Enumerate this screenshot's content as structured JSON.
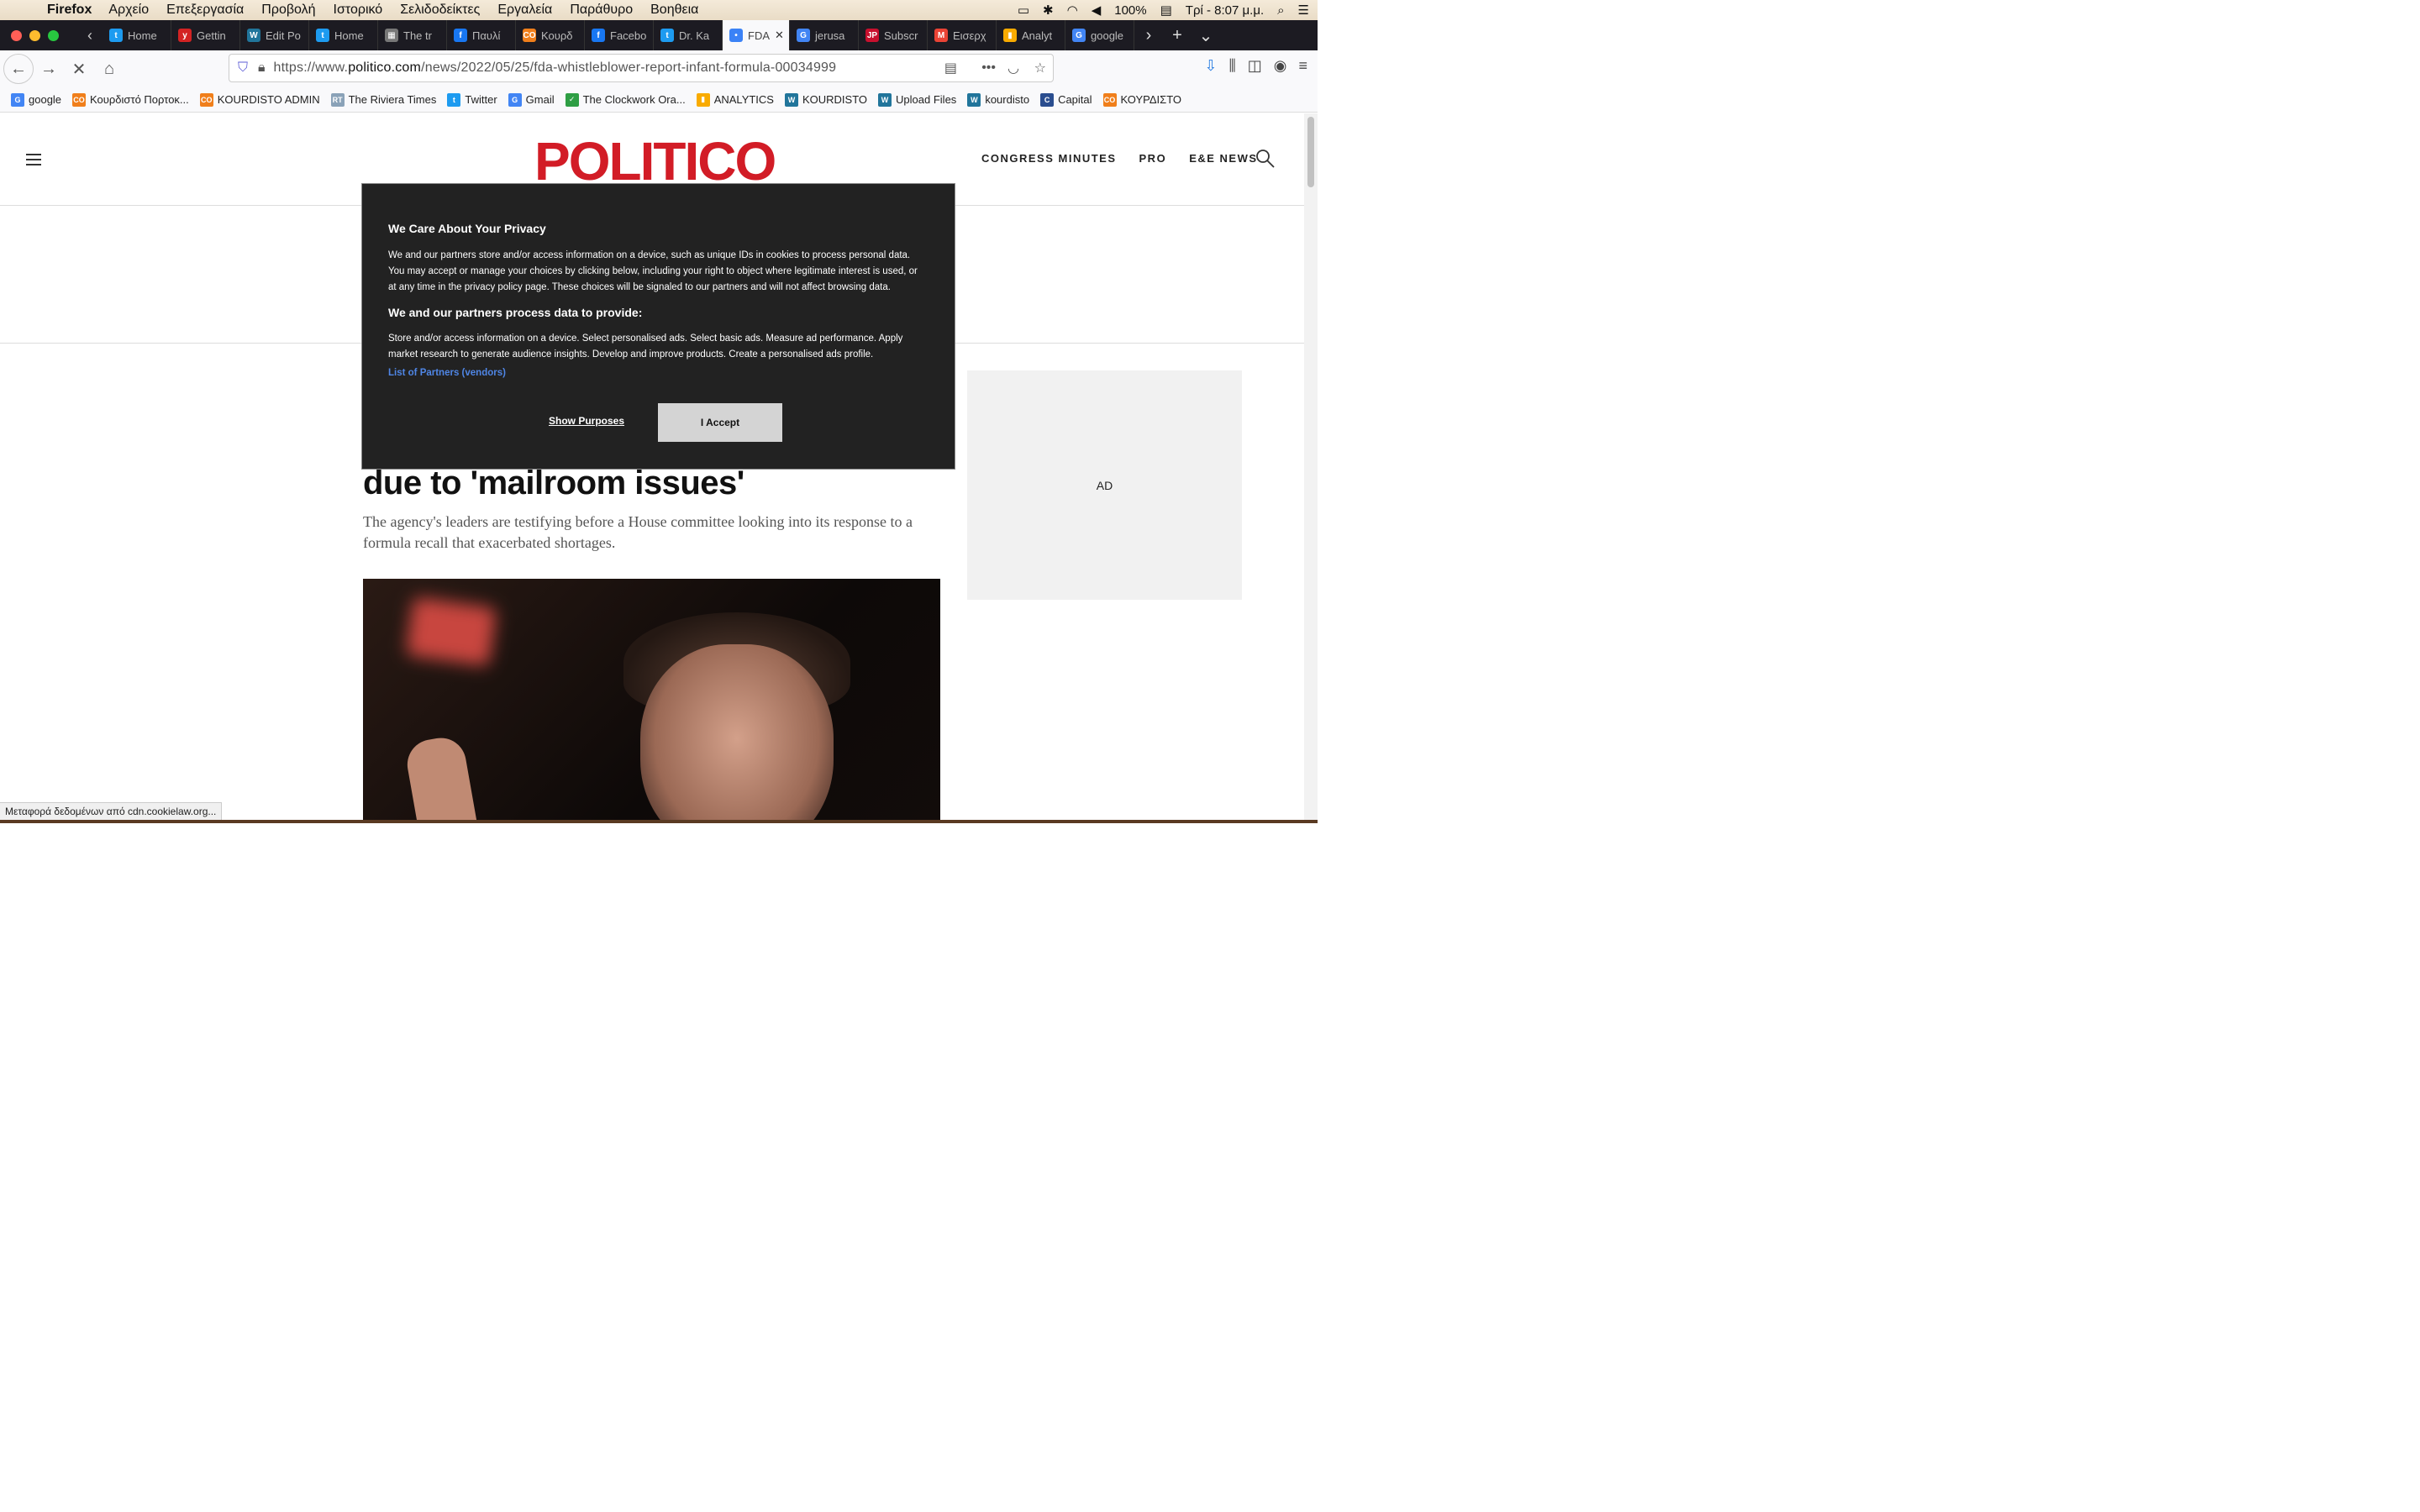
{
  "macmenu": {
    "app": "Firefox",
    "items": [
      "Αρχείο",
      "Επεξεργασία",
      "Προβολή",
      "Ιστορικό",
      "Σελιδοδείκτες",
      "Εργαλεία",
      "Παράθυρο",
      "Βοηθεια"
    ],
    "battery": "100%",
    "clock": "Τρί - 8:07 μ.μ."
  },
  "tabs": [
    {
      "label": "Home",
      "icon": "twitter-icon",
      "color": "#1d9bf0",
      "glyph": "t"
    },
    {
      "label": "Gettin",
      "icon": "yelp-icon",
      "color": "#d32323",
      "glyph": "y"
    },
    {
      "label": "Edit Po",
      "icon": "wordpress-icon",
      "color": "#21759b",
      "glyph": "W"
    },
    {
      "label": "Home",
      "icon": "twitter-icon",
      "color": "#1d9bf0",
      "glyph": "t"
    },
    {
      "label": "The tr",
      "icon": "site-icon",
      "color": "#777",
      "glyph": "▦"
    },
    {
      "label": "Παυλί",
      "icon": "facebook-icon",
      "color": "#1877f2",
      "glyph": "f"
    },
    {
      "label": "Κουρδ",
      "icon": "kourdisto-icon",
      "color": "#f07f1b",
      "glyph": "CO"
    },
    {
      "label": "Facebo",
      "icon": "facebook-icon",
      "color": "#1877f2",
      "glyph": "f"
    },
    {
      "label": "Dr. Ka",
      "icon": "twitter-icon",
      "color": "#1d9bf0",
      "glyph": "t"
    },
    {
      "label": "FDA",
      "icon": "loading-icon",
      "color": "#3b82f6",
      "glyph": "•",
      "active": true
    },
    {
      "label": "jerusa",
      "icon": "google-icon",
      "color": "#4285f4",
      "glyph": "G"
    },
    {
      "label": "Subscr",
      "icon": "jpost-icon",
      "color": "#c8102e",
      "glyph": "JP"
    },
    {
      "label": "Εισερχ",
      "icon": "gmail-icon",
      "color": "#ea4335",
      "glyph": "M"
    },
    {
      "label": "Analyt",
      "icon": "analytics-icon",
      "color": "#f9ab00",
      "glyph": "▮"
    },
    {
      "label": "google",
      "icon": "google-icon",
      "color": "#4285f4",
      "glyph": "G"
    }
  ],
  "address": {
    "prefix": "https://www.",
    "domain": "politico.com",
    "path": "/news/2022/05/25/fda-whistleblower-report-infant-formula-00034999"
  },
  "bookmarks": [
    {
      "label": "google",
      "icon": "google-icon",
      "color": "#4285f4",
      "glyph": "G"
    },
    {
      "label": "Κουρδιστό Πορτοκ...",
      "icon": "kourdisto-icon",
      "color": "#f07f1b",
      "glyph": "CO"
    },
    {
      "label": "KOURDISTO ADMIN",
      "icon": "kourdisto-icon",
      "color": "#f07f1b",
      "glyph": "CO"
    },
    {
      "label": "The Riviera Times",
      "icon": "rt-icon",
      "color": "#8aa2b8",
      "glyph": "RT"
    },
    {
      "label": "Twitter",
      "icon": "twitter-icon",
      "color": "#1d9bf0",
      "glyph": "t"
    },
    {
      "label": "Gmail",
      "icon": "google-icon",
      "color": "#4285f4",
      "glyph": "G"
    },
    {
      "label": "The Clockwork Ora...",
      "icon": "check-icon",
      "color": "#2e9e44",
      "glyph": "✓"
    },
    {
      "label": "ANALYTICS",
      "icon": "analytics-icon",
      "color": "#f9ab00",
      "glyph": "▮"
    },
    {
      "label": "KOURDISTO",
      "icon": "wordpress-icon",
      "color": "#21759b",
      "glyph": "W"
    },
    {
      "label": "Upload Files",
      "icon": "wordpress-icon",
      "color": "#21759b",
      "glyph": "W"
    },
    {
      "label": "kourdisto",
      "icon": "wordpress-icon",
      "color": "#21759b",
      "glyph": "W"
    },
    {
      "label": "Capital",
      "icon": "capital-icon",
      "color": "#2a4d8f",
      "glyph": "C"
    },
    {
      "label": "ΚΟΥΡΔΙΣΤΟ",
      "icon": "kourdisto-icon",
      "color": "#f07f1b",
      "glyph": "CO"
    }
  ],
  "site": {
    "logo": "POLITICO",
    "nav": [
      "CONGRESS MINUTES",
      "PRO",
      "E&E NEWS"
    ]
  },
  "article": {
    "headline_visible": "due to 'mailroom issues'",
    "dek": "The agency's leaders are testifying before a House committee looking into its response to a formula recall that exacerbated shortages."
  },
  "ad_label": "AD",
  "consent": {
    "title": "We Care About Your Privacy",
    "body": "We and our partners store and/or access information on a device, such as unique IDs in cookies to process personal data. You may accept or manage your choices by clicking below, including your right to object where legitimate interest is used, or at any time in the privacy policy page. These choices will be signaled to our partners and will not affect browsing data.",
    "subtitle": "We and our partners process data to provide:",
    "purposes": "Store and/or access information on a device. Select personalised ads. Select basic ads. Measure ad performance. Apply market research to generate audience insights. Develop and improve products. Create a personalised ads profile.",
    "partners_link": "List of Partners (vendors)",
    "show_purposes": "Show Purposes",
    "accept": "I Accept"
  },
  "status_text": "Μεταφορά δεδομένων από cdn.cookielaw.org...",
  "colors": {
    "brand": "#d21c26",
    "modal_bg": "#222222",
    "link": "#4f86e6"
  }
}
